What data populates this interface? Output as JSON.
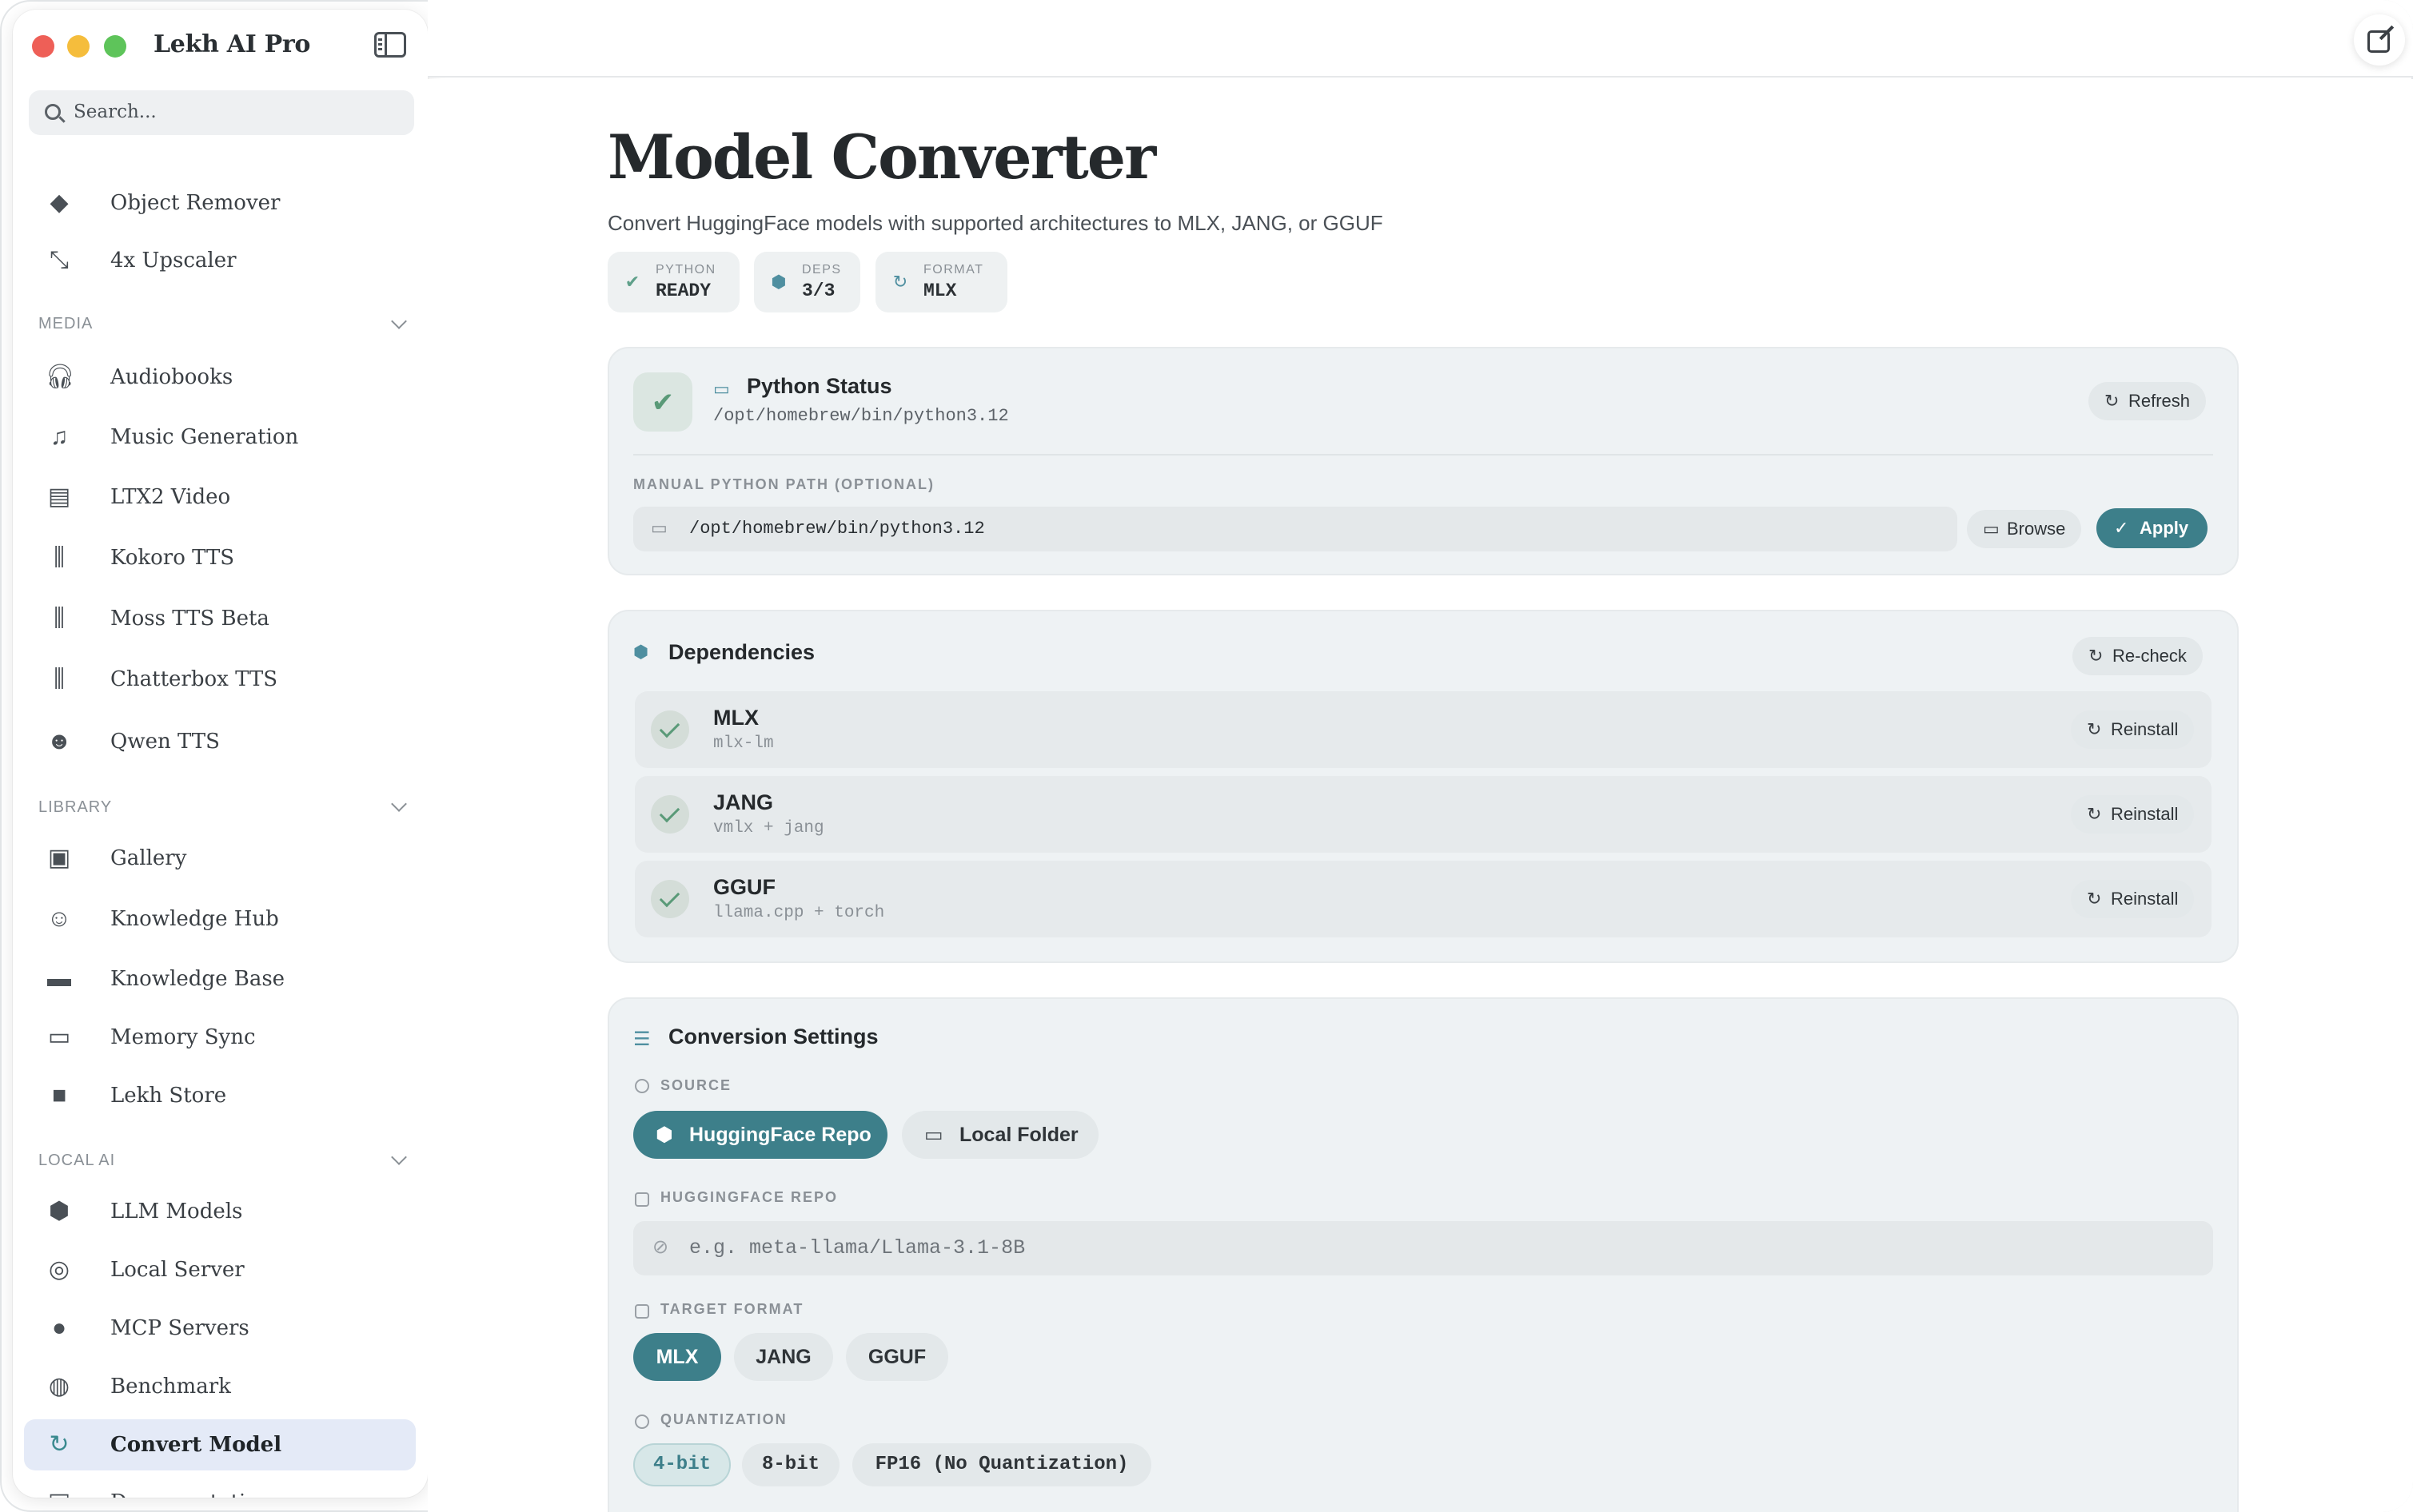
{
  "app": {
    "title": "Lekh AI Pro"
  },
  "search": {
    "placeholder": "Search..."
  },
  "sidebar": {
    "items_top": [
      {
        "label": "Object Remover",
        "icon": "eraser-icon"
      },
      {
        "label": "4x Upscaler",
        "icon": "expand-icon"
      }
    ],
    "sections": [
      {
        "title": "MEDIA",
        "items": [
          {
            "label": "Audiobooks",
            "icon": "headphones-icon"
          },
          {
            "label": "Music Generation",
            "icon": "music-icon"
          },
          {
            "label": "LTX2 Video",
            "icon": "film-icon"
          },
          {
            "label": "Kokoro TTS",
            "icon": "waveform-icon"
          },
          {
            "label": "Moss TTS Beta",
            "icon": "waveform-icon"
          },
          {
            "label": "Chatterbox TTS",
            "icon": "waveform-icon"
          },
          {
            "label": "Qwen TTS",
            "icon": "masks-icon"
          }
        ]
      },
      {
        "title": "LIBRARY",
        "items": [
          {
            "label": "Gallery",
            "icon": "gallery-icon"
          },
          {
            "label": "Knowledge Hub",
            "icon": "brain-icon"
          },
          {
            "label": "Knowledge Base",
            "icon": "folder-icon"
          },
          {
            "label": "Memory Sync",
            "icon": "folder-sync-icon"
          },
          {
            "label": "Lekh Store",
            "icon": "bag-icon"
          }
        ]
      },
      {
        "title": "LOCAL AI",
        "items": [
          {
            "label": "LLM Models",
            "icon": "cube-icon"
          },
          {
            "label": "Local Server",
            "icon": "globe-icon"
          },
          {
            "label": "MCP Servers",
            "icon": "mcp-icon"
          },
          {
            "label": "Benchmark",
            "icon": "gauge-icon"
          },
          {
            "label": "Convert Model",
            "icon": "convert-icon"
          },
          {
            "label": "Documentation",
            "icon": "doc-icon"
          }
        ]
      }
    ]
  },
  "page": {
    "title": "Model Converter",
    "subtitle": "Convert HuggingFace models with supported architectures to MLX, JANG, or GGUF",
    "status_pills": [
      {
        "key": "PYTHON",
        "value": "READY"
      },
      {
        "key": "DEPS",
        "value": "3/3"
      },
      {
        "key": "FORMAT",
        "value": "MLX"
      }
    ]
  },
  "python_status": {
    "title": "Python Status",
    "path": "/opt/homebrew/bin/python3.12",
    "refresh_label": "Refresh",
    "manual_label": "MANUAL PYTHON PATH (OPTIONAL)",
    "manual_value": "/opt/homebrew/bin/python3.12",
    "browse_label": "Browse",
    "apply_label": "Apply"
  },
  "dependencies": {
    "title": "Dependencies",
    "recheck_label": "Re-check",
    "items": [
      {
        "name": "MLX",
        "package": "mlx-lm",
        "action": "Reinstall"
      },
      {
        "name": "JANG",
        "package": "vmlx + jang",
        "action": "Reinstall"
      },
      {
        "name": "GGUF",
        "package": "llama.cpp + torch",
        "action": "Reinstall"
      }
    ]
  },
  "conversion": {
    "title": "Conversion Settings",
    "source_label": "SOURCE",
    "source_options": [
      "HuggingFace Repo",
      "Local Folder"
    ],
    "source_selected": "HuggingFace Repo",
    "repo_label": "HUGGINGFACE REPO",
    "repo_placeholder": "e.g. meta-llama/Llama-3.1-8B",
    "format_label": "TARGET FORMAT",
    "format_options": [
      "MLX",
      "JANG",
      "GGUF"
    ],
    "format_selected": "MLX",
    "quant_label": "QUANTIZATION",
    "quant_options": [
      "4-bit",
      "8-bit",
      "FP16 (No Quantization)"
    ],
    "quant_selected": "4-bit"
  },
  "colors": {
    "accent": "#3d7f8a",
    "active_nav_bg": "#e4eaf7",
    "success": "#5a9a78"
  }
}
